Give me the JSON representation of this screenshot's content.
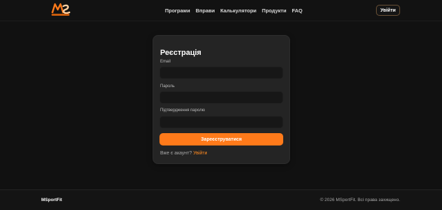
{
  "header": {
    "logo_icon": "msportfit-logo",
    "nav": [
      {
        "label": "Програми"
      },
      {
        "label": "Вправи"
      },
      {
        "label": "Калькулятори"
      },
      {
        "label": "Продукти"
      },
      {
        "label": "FAQ"
      }
    ],
    "login_button": "Увійти"
  },
  "register_form": {
    "title": "Реєстрація",
    "fields": [
      {
        "label": "Email",
        "value": "",
        "placeholder": ""
      },
      {
        "label": "Пароль",
        "value": "",
        "placeholder": ""
      },
      {
        "label": "Підтвердження паролю",
        "value": "",
        "placeholder": ""
      }
    ],
    "submit_label": "Зареєструватися",
    "have_account_text": "Вже є акаунт?",
    "login_link": "Увійти"
  },
  "footer": {
    "brand": "MSportFit",
    "copyright": "© 2026 MSportFit. Всі права захищено."
  },
  "colors": {
    "background": "#111111",
    "card": "#242424",
    "accent": "#ff7a1a",
    "input": "#171717"
  }
}
